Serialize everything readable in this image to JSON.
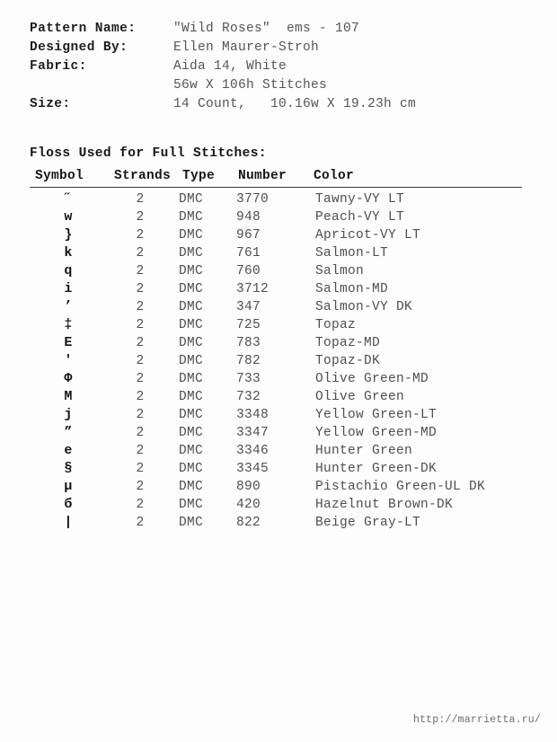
{
  "document": {
    "header": {
      "rows": [
        {
          "label": "Pattern Name:",
          "value": "\"Wild Roses\"  ems - 107"
        },
        {
          "label": "Designed By:",
          "value": "Ellen Maurer-Stroh"
        },
        {
          "label": "Fabric:",
          "value": "Aida 14, White"
        },
        {
          "label": "",
          "value": "56w X 106h Stitches"
        },
        {
          "label": "Size:",
          "value": "14 Count,   10.16w X 19.23h cm"
        }
      ]
    },
    "section_title": "Floss Used for Full Stitches:",
    "table": {
      "columns": [
        "Symbol",
        "Strands",
        "Type",
        "Number",
        "Color"
      ],
      "rows": [
        {
          "symbol": "˝",
          "strands": "2",
          "type": "DMC",
          "number": "3770",
          "color": "Tawny-VY LT"
        },
        {
          "symbol": "w",
          "strands": "2",
          "type": "DMC",
          "number": "948",
          "color": "Peach-VY LT"
        },
        {
          "symbol": "}",
          "strands": "2",
          "type": "DMC",
          "number": "967",
          "color": "Apricot-VY LT"
        },
        {
          "symbol": "k",
          "strands": "2",
          "type": "DMC",
          "number": "761",
          "color": "Salmon-LT"
        },
        {
          "symbol": "q",
          "strands": "2",
          "type": "DMC",
          "number": "760",
          "color": "Salmon"
        },
        {
          "symbol": "i",
          "strands": "2",
          "type": "DMC",
          "number": "3712",
          "color": "Salmon-MD"
        },
        {
          "symbol": "’",
          "strands": "2",
          "type": "DMC",
          "number": "347",
          "color": "Salmon-VY DK"
        },
        {
          "symbol": "‡",
          "strands": "2",
          "type": "DMC",
          "number": "725",
          "color": "Topaz"
        },
        {
          "symbol": "E",
          "strands": "2",
          "type": "DMC",
          "number": "783",
          "color": "Topaz-MD"
        },
        {
          "symbol": "'",
          "strands": "2",
          "type": "DMC",
          "number": "782",
          "color": "Topaz-DK"
        },
        {
          "symbol": "Φ",
          "strands": "2",
          "type": "DMC",
          "number": "733",
          "color": "Olive Green-MD"
        },
        {
          "symbol": "M",
          "strands": "2",
          "type": "DMC",
          "number": "732",
          "color": "Olive Green"
        },
        {
          "symbol": "j",
          "strands": "2",
          "type": "DMC",
          "number": "3348",
          "color": "Yellow Green-LT"
        },
        {
          "symbol": "”",
          "strands": "2",
          "type": "DMC",
          "number": "3347",
          "color": "Yellow Green-MD"
        },
        {
          "symbol": "e",
          "strands": "2",
          "type": "DMC",
          "number": "3346",
          "color": "Hunter Green"
        },
        {
          "symbol": "§",
          "strands": "2",
          "type": "DMC",
          "number": "3345",
          "color": "Hunter Green-DK"
        },
        {
          "symbol": "µ",
          "strands": "2",
          "type": "DMC",
          "number": "890",
          "color": "Pistachio Green-UL DK"
        },
        {
          "symbol": "б",
          "strands": "2",
          "type": "DMC",
          "number": "420",
          "color": "Hazelnut Brown-DK"
        },
        {
          "symbol": "|",
          "strands": "2",
          "type": "DMC",
          "number": "822",
          "color": "Beige Gray-LT"
        }
      ]
    },
    "watermark": "http://marrietta.ru/"
  }
}
